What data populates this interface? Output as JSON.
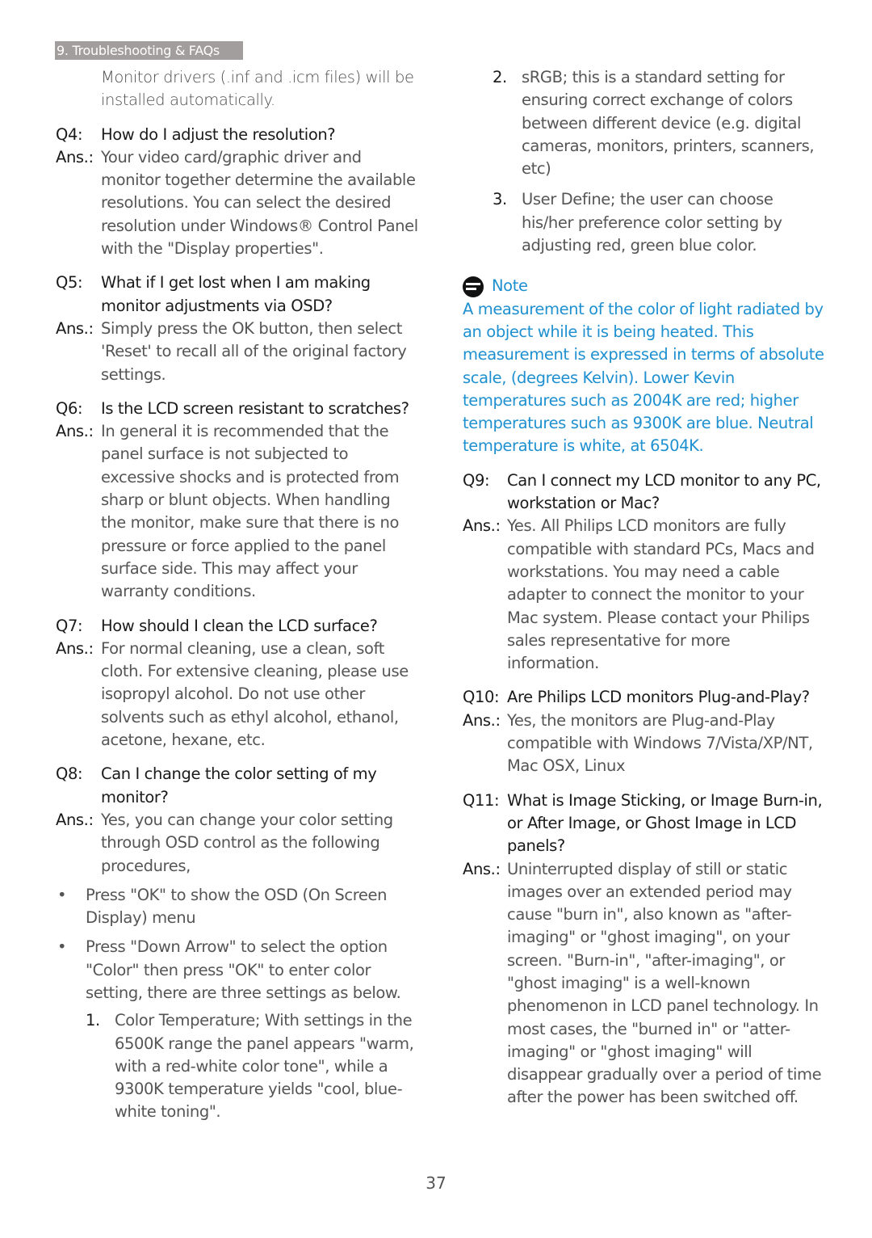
{
  "header": {
    "section_tab": "9. Troubleshooting & FAQs"
  },
  "left": {
    "intro": "Monitor drivers (.inf and .icm files) will be installed automatically.",
    "q4": {
      "label": "Q4:",
      "question": "How do I adjust the resolution?",
      "ans_label": "Ans.:",
      "answer": "Your video card/graphic driver and monitor together determine the available resolutions. You can select the desired resolution under Windows® Control Panel with the \"Display properties\"."
    },
    "q5": {
      "label": "Q5:",
      "question": "What if I get lost when I am making monitor adjustments via OSD?",
      "ans_label": "Ans.:",
      "answer": "Simply press the OK button, then select 'Reset' to recall all of the original factory settings."
    },
    "q6": {
      "label": "Q6:",
      "question": "Is the LCD screen resistant to scratches?",
      "ans_label": "Ans.:",
      "answer": "In general it is recommended that the panel surface is not subjected to excessive shocks and is protected from sharp or blunt objects. When handling the monitor, make sure that there is no pressure or force applied to the panel surface side. This may affect your warranty conditions."
    },
    "q7": {
      "label": "Q7:",
      "question": "How should I clean the LCD surface?",
      "ans_label": "Ans.:",
      "answer": "For normal cleaning, use a clean, soft cloth. For extensive cleaning, please use isopropyl alcohol. Do not use other solvents such as ethyl alcohol, ethanol, acetone, hexane, etc."
    },
    "q8": {
      "label": "Q8:",
      "question": "Can I change the color setting of my monitor?",
      "ans_label": "Ans.:",
      "answer": "Yes, you can change your color setting through OSD control as the following procedures,"
    },
    "bullets": [
      "Press \"OK\" to show the OSD (On Screen Display) menu",
      "Press \"Down Arrow\" to select the option \"Color\" then press \"OK\" to enter color setting, there are three settings as below."
    ],
    "numbered_1": {
      "n": "1.",
      "text": "Color Temperature; With settings in the 6500K range the panel appears \"warm, with a red-white color tone\", while a 9300K temperature yields \"cool, blue-white toning\"."
    }
  },
  "right": {
    "numbered": [
      {
        "n": "2.",
        "text": "sRGB; this is a standard setting for ensuring correct exchange of colors between different device (e.g. digital cameras, monitors, printers, scanners, etc)"
      },
      {
        "n": "3.",
        "text": "User Define; the user can choose his/her preference color setting by adjusting red, green blue color."
      }
    ],
    "note": {
      "title": "Note",
      "body": "A measurement of the color of light radiated by an object while it is being heated. This measurement is expressed in terms of absolute scale, (degrees Kelvin). Lower Kevin temperatures such as 2004K are red; higher temperatures such as 9300K are blue. Neutral temperature is white, at 6504K.",
      "color": "#1e90d0"
    },
    "q9": {
      "label": "Q9:",
      "question": "Can I connect my LCD monitor to any PC, workstation or Mac?",
      "ans_label": "Ans.:",
      "answer": "Yes. All Philips LCD monitors are fully compatible with standard PCs, Macs and workstations. You may need a cable adapter to connect the monitor to your Mac system. Please contact your Philips sales representative for more information."
    },
    "q10": {
      "label": "Q10:",
      "question": "Are Philips LCD monitors Plug-and-Play?",
      "ans_label": "Ans.:",
      "answer": "Yes, the monitors are Plug-and-Play compatible with Windows 7/Vista/XP/NT, Mac OSX, Linux"
    },
    "q11": {
      "label": "Q11:",
      "question": "What is Image Sticking, or Image Burn-in, or After Image, or Ghost Image in LCD panels?",
      "ans_label": "Ans.:",
      "answer": "Uninterrupted display of still or static images over an extended period may cause \"burn in\", also known as \"after-imaging\" or \"ghost imaging\", on your screen. \"Burn-in\", \"after-imaging\", or \"ghost imaging\" is a well-known phenomenon in LCD panel technology. In most cases, the \"burned in\" or \"atter-imaging\" or \"ghost imaging\" will disappear gradually over a period of time after the power has been switched off."
    }
  },
  "footer": {
    "page_number": "37"
  }
}
